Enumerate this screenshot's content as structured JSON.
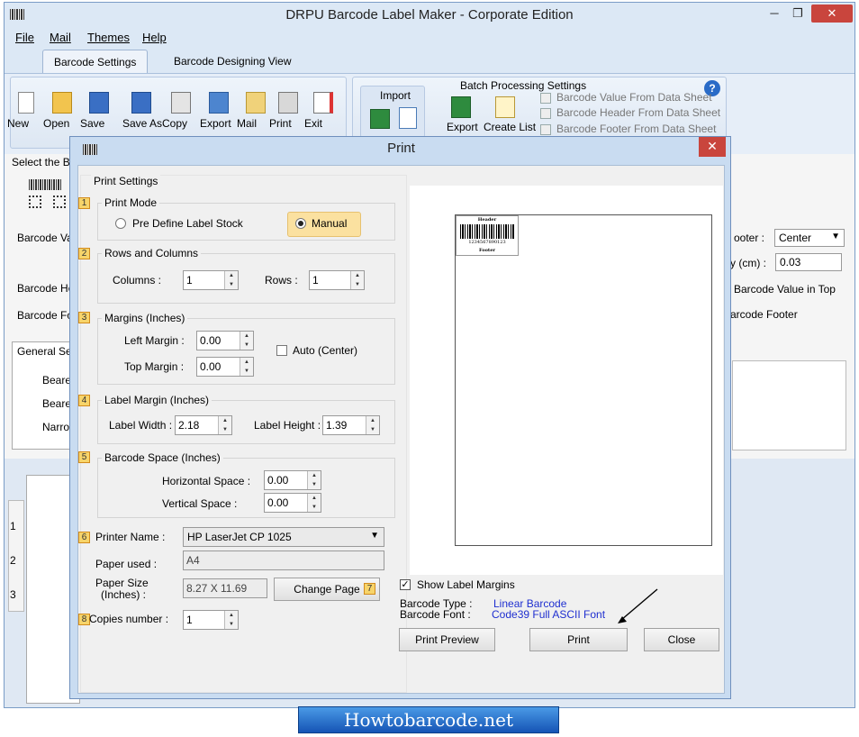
{
  "app": {
    "title": "DRPU Barcode Label Maker - Corporate Edition",
    "controls": {
      "minimize": "─",
      "maximize": "❐",
      "close": "✕"
    }
  },
  "menu": [
    "File",
    "Mail",
    "Themes",
    "Help"
  ],
  "tabs": [
    "Barcode Settings",
    "Barcode Designing View"
  ],
  "toolbar": {
    "buttons": [
      "New",
      "Open",
      "Save",
      "Save As",
      "Copy",
      "Export",
      "Mail",
      "Print",
      "Exit"
    ],
    "import_label": "Import",
    "batch_title": "Batch Processing Settings",
    "batch_buttons": [
      "Export",
      "Create List"
    ],
    "batch_options": [
      "Barcode Value From Data Sheet",
      "Barcode Header From Data Sheet",
      "Barcode Footer From Data Sheet"
    ],
    "help_icon": "?"
  },
  "background": {
    "select_label": "Select the Bar",
    "left_labels": [
      "Barcode Valu",
      "Barcode Hea",
      "Barcode Foo"
    ],
    "general_tab": "General Setti",
    "general_items": [
      "Beare",
      "Beare",
      "Narro"
    ],
    "right_labels": [
      "ooter :",
      "y (cm) :",
      "Barcode Value in Top",
      "arcode Footer"
    ],
    "footer_select": "Center",
    "cm_value": "0.03",
    "ruler_marks": [
      "1",
      "2",
      "3"
    ]
  },
  "dialog": {
    "title": "Print",
    "close": "✕",
    "print_settings": "Print Settings",
    "print_mode": {
      "num": "1",
      "legend": "Print Mode",
      "option_predefine": "Pre Define Label Stock",
      "option_manual": "Manual"
    },
    "rows_columns": {
      "num": "2",
      "legend": "Rows and Columns",
      "columns_label": "Columns :",
      "columns_value": "1",
      "rows_label": "Rows :",
      "rows_value": "1"
    },
    "margins": {
      "num": "3",
      "legend": "Margins (Inches)",
      "left_label": "Left Margin :",
      "left_value": "0.00",
      "top_label": "Top Margin :",
      "top_value": "0.00",
      "auto_label": "Auto (Center)"
    },
    "label_margin": {
      "num": "4",
      "legend": "Label Margin (Inches)",
      "width_label": "Label Width :",
      "width_value": "2.18",
      "height_label": "Label Height :",
      "height_value": "1.39"
    },
    "barcode_space": {
      "num": "5",
      "legend": "Barcode Space (Inches)",
      "h_label": "Horizontal Space :",
      "h_value": "0.00",
      "v_label": "Vertical Space :",
      "v_value": "0.00"
    },
    "printer": {
      "num": "6",
      "label": "Printer Name :",
      "value": "HP LaserJet CP 1025",
      "paper_used_label": "Paper used :",
      "paper_used_value": "A4",
      "paper_size_label": "Paper Size",
      "paper_size_unit": "(Inches) :",
      "paper_size_value": "8.27 X 11.69",
      "change_page": "Change Page",
      "change_page_num": "7"
    },
    "copies": {
      "num": "8",
      "label": "Copies number :",
      "value": "1"
    },
    "preview_label": {
      "header": "Header",
      "digits": "1234567890123",
      "footer": "Footer"
    },
    "show_margins_label": "Show Label Margins",
    "barcode_type_label": "Barcode Type :",
    "barcode_type_value": "Linear Barcode",
    "barcode_font_label": "Barcode Font :",
    "barcode_font_value": "Code39 Full ASCII Font",
    "buttons": {
      "preview": "Print Preview",
      "print": "Print",
      "close": "Close"
    }
  },
  "banner": "Howtobarcode.net"
}
